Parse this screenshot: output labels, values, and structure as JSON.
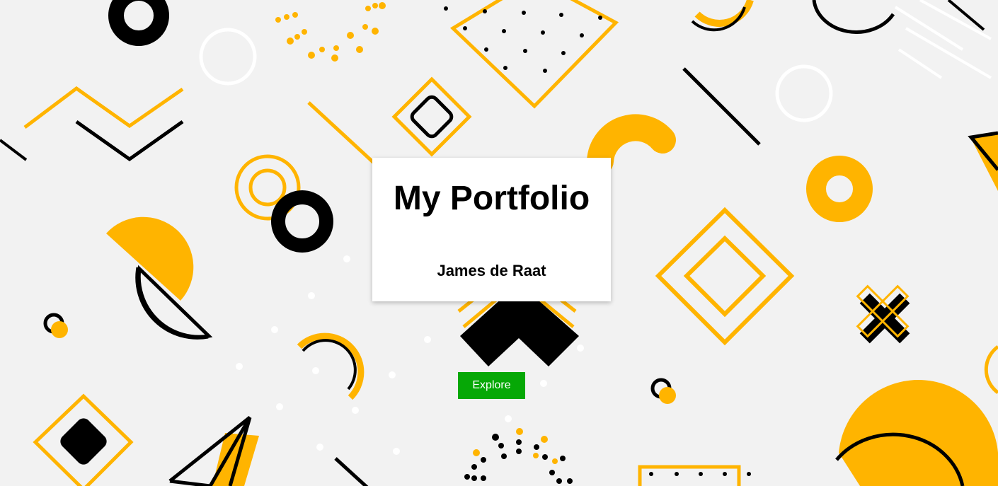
{
  "hero": {
    "title": "My Portfolio",
    "author": "James de Raat",
    "button_label": "Explore"
  },
  "colors": {
    "background": "#f2f2f2",
    "accent_yellow": "#ffb400",
    "ink": "#000000",
    "card": "#ffffff",
    "button": "#06a806",
    "button_text": "#ffffff"
  }
}
